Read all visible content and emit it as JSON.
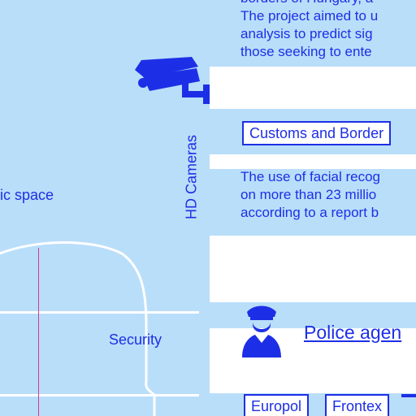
{
  "left": {
    "public_space_label": "ic space",
    "security_label": "Security",
    "hd_cameras_label": "HD Cameras"
  },
  "right": {
    "top_paragraph": [
      "borders of Hungary, a",
      "The project aimed to u",
      "analysis to predict sig",
      "those seeking to ente"
    ],
    "customs_tag": "Customs and Border",
    "facial_paragraph": [
      "The use of facial recog",
      "on more than 23 millio",
      "according to a report b"
    ],
    "police_link": "Police agen",
    "tags": [
      "Europol",
      "Frontex"
    ]
  },
  "colors": {
    "panel_blue": "#b9defa",
    "ink_blue": "#1d2fe6",
    "pink_line": "#d23c8c"
  },
  "icons": [
    "cctv-camera-icon",
    "police-officer-icon"
  ]
}
